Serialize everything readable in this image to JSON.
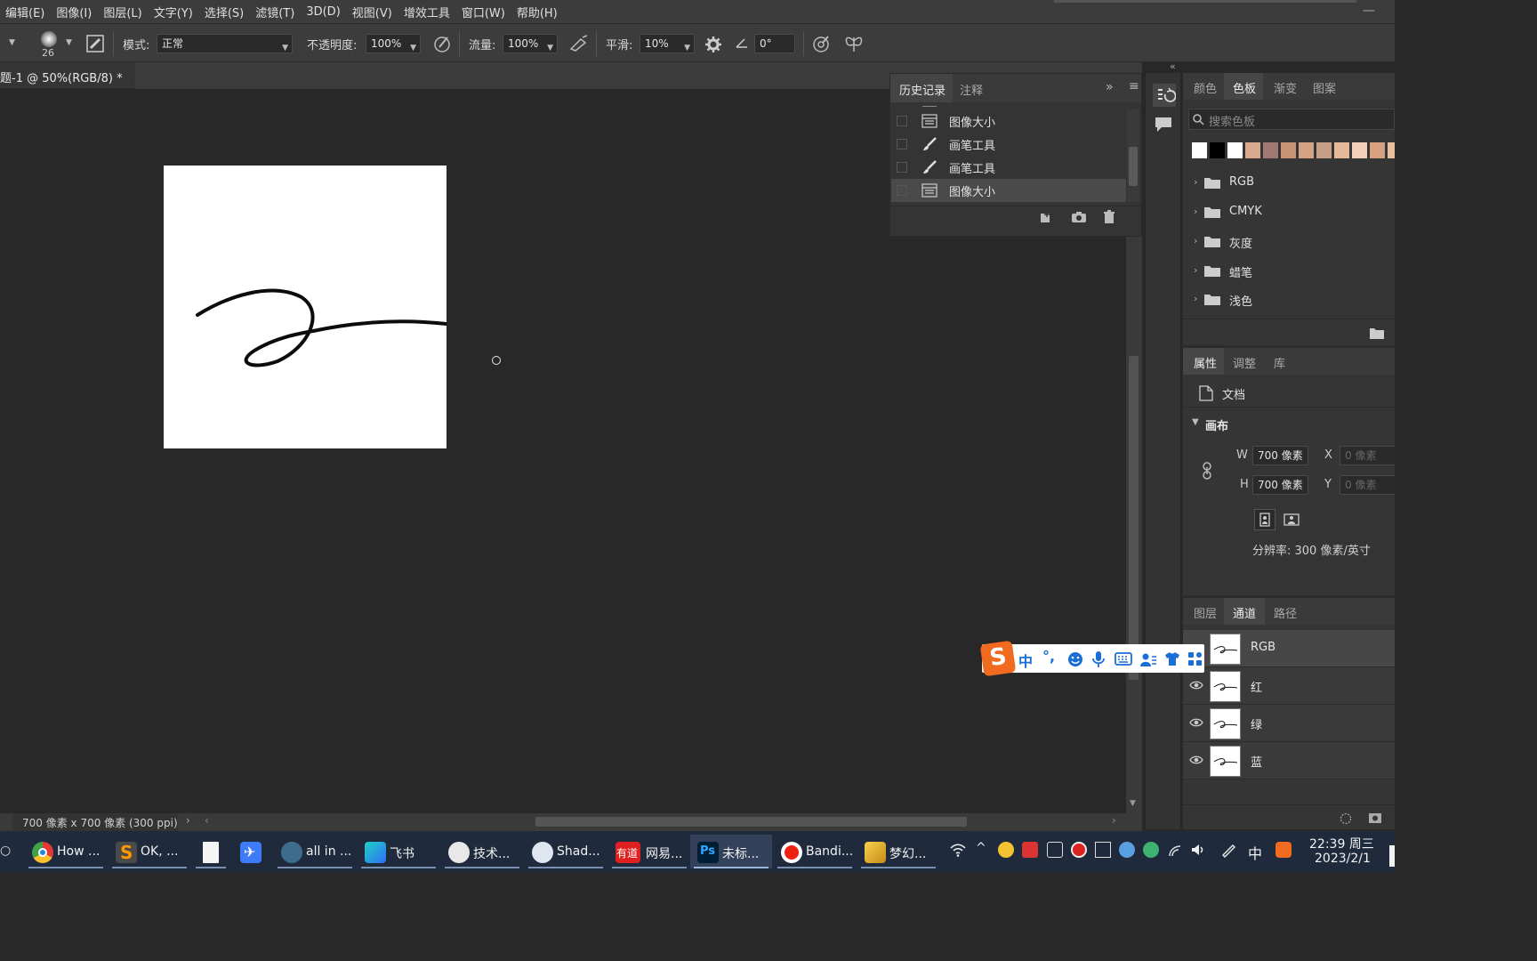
{
  "menu": [
    "编辑(E)",
    "图像(I)",
    "图层(L)",
    "文字(Y)",
    "选择(S)",
    "滤镜(T)",
    "3D(D)",
    "视图(V)",
    "增效工具",
    "窗口(W)",
    "帮助(H)"
  ],
  "window_min": "—",
  "options": {
    "brush_size": "26",
    "mode_label": "模式:",
    "mode_value": "正常",
    "opacity_label": "不透明度:",
    "opacity_value": "100%",
    "flow_label": "流量:",
    "flow_value": "100%",
    "smooth_label": "平滑:",
    "smooth_value": "10%",
    "angle_value": "0°"
  },
  "document": {
    "tab_title": "题-1 @ 50%(RGB/8) *",
    "close": "×",
    "status": "700 像素 x 700 像素 (300 ppi)",
    "status_arrow": "›",
    "scroll_left": "‹",
    "scroll_right": "›"
  },
  "history": {
    "tabs": [
      "历史记录",
      "注释"
    ],
    "rows": [
      "图像大小",
      "画笔工具",
      "画笔工具",
      "图像大小"
    ],
    "expand": "»",
    "menu": "≡"
  },
  "swatches": {
    "tabs": [
      "颜色",
      "色板",
      "渐变",
      "图案"
    ],
    "search_placeholder": "搜索色板",
    "colors": [
      "#ffffff",
      "#000000",
      "#ffffff",
      "#d8a98a",
      "#a07a72",
      "#c89474",
      "#d4a284",
      "#c8a088",
      "#e4b898",
      "#f0d0b8",
      "#d8a080",
      "#e8c0a0"
    ],
    "groups": [
      "RGB",
      "CMYK",
      "灰度",
      "蜡笔",
      "浅色"
    ]
  },
  "properties": {
    "tabs": [
      "属性",
      "调整",
      "库"
    ],
    "doc_label": "文档",
    "canvas_label": "画布",
    "w_label": "W",
    "w_value": "700 像素",
    "h_label": "H",
    "h_value": "700 像素",
    "x_label": "X",
    "x_value": "0 像素",
    "y_label": "Y",
    "y_value": "0 像素",
    "resolution": "分辨率: 300 像素/英寸"
  },
  "channels": {
    "tabs": [
      "图层",
      "通道",
      "路径"
    ],
    "rows": [
      "RGB",
      "红",
      "绿",
      "蓝"
    ]
  },
  "ime": {
    "logo": "S",
    "mode": "中",
    "punct": "°,"
  },
  "taskbar": {
    "apps": [
      "How ...",
      "OK, ...",
      "",
      "",
      "all in ...",
      "飞书",
      "技术...",
      "Shad...",
      "网易...",
      "未标...",
      "Bandi...",
      "梦幻..."
    ],
    "icons": [
      "chrome-icon",
      "sublime-icon",
      "file-icon",
      "feishu-bird-icon",
      "tool-icon",
      "feishu-icon",
      "avatar-icon",
      "shadow-icon",
      "youdao-icon",
      "photoshop-icon",
      "bandicam-icon",
      "game-icon"
    ],
    "youdao_badge": "有道",
    "ps_badge": "Ps",
    "ime": "中",
    "clock_time": "22:39 周三",
    "clock_date": "2023/2/1"
  }
}
